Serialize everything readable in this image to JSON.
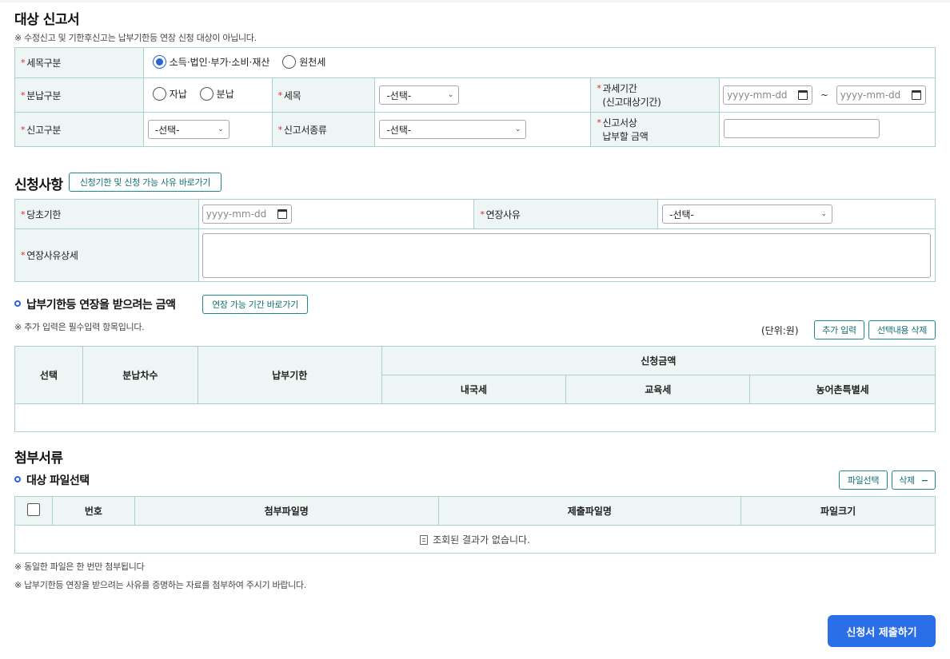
{
  "section1": {
    "title": "대상 신고서",
    "note": "※ 수정신고 및 기한후신고는 납부기한등 연장 신청 대상이 아닙니다.",
    "tax_type_label": "세목구분",
    "tax_type_options": [
      "소득·법인·부가·소비·재산",
      "원천세"
    ],
    "tax_type_selected": "소득·법인·부가·소비·재산",
    "installment_label": "분납구분",
    "installment_options": [
      "자납",
      "분납"
    ],
    "tax_item_label": "세목",
    "tax_item_value": "-선택-",
    "period_label_1": "과세기간",
    "period_label_2": "(신고대상기간)",
    "period_from_placeholder": "yyyy-mm-dd",
    "period_to_placeholder": "yyyy-mm-dd",
    "period_sep": "~",
    "report_type_label": "신고구분",
    "report_type_value": "-선택-",
    "report_kind_label": "신고서종류",
    "report_kind_value": "-선택-",
    "amount_label_1": "신고서상",
    "amount_label_2": "납부할 금액",
    "amount_value": ""
  },
  "section2": {
    "title": "신청사항",
    "link_button": "신청기한 및 신청 가능 사유 바로가기",
    "deadline_label": "당초기한",
    "deadline_placeholder": "yyyy-mm-dd",
    "reason_label": "연장사유",
    "reason_value": "-선택-",
    "reason_detail_label": "연장사유상세",
    "reason_detail_value": ""
  },
  "section3": {
    "title": "납부기한등 연장을 받으려는 금액",
    "link_button": "연장 가능 기간 바로가기",
    "note": "※ 추가 입력은 필수입력 항목입니다.",
    "unit": "(단위:원)",
    "add_button": "추가 입력",
    "delete_button": "선택내용 삭제",
    "columns": {
      "select": "선택",
      "installment_no": "분납차수",
      "due_date": "납부기한",
      "request_amount": "신청금액",
      "national_tax": "내국세",
      "education_tax": "교육세",
      "rural_tax": "농어촌특별세"
    }
  },
  "section4": {
    "title": "첨부서류",
    "subtitle": "대상 파일선택",
    "file_select_button": "파일선택",
    "delete_button": "삭제",
    "delete_symbol": "−",
    "columns": {
      "number": "번호",
      "attach_name": "첨부파일명",
      "submit_name": "제출파일명",
      "file_size": "파일크기"
    },
    "empty_message": "조회된 결과가 없습니다.",
    "note1": "※ 동일한 파일은 한 번만 첨부됩니다",
    "note2": "※ 납부기한등 연장을 받으려는 사유를 증명하는 자료를 첨부하여 주시기 바랍니다."
  },
  "submit_button": "신청서 제출하기",
  "required_mark": "*",
  "colors": {
    "accent": "#2a6ee8",
    "label_bg": "#eef6f5",
    "border": "#a9cfd0",
    "outline_button": "#1d8a8f",
    "required": "#d6262f"
  }
}
